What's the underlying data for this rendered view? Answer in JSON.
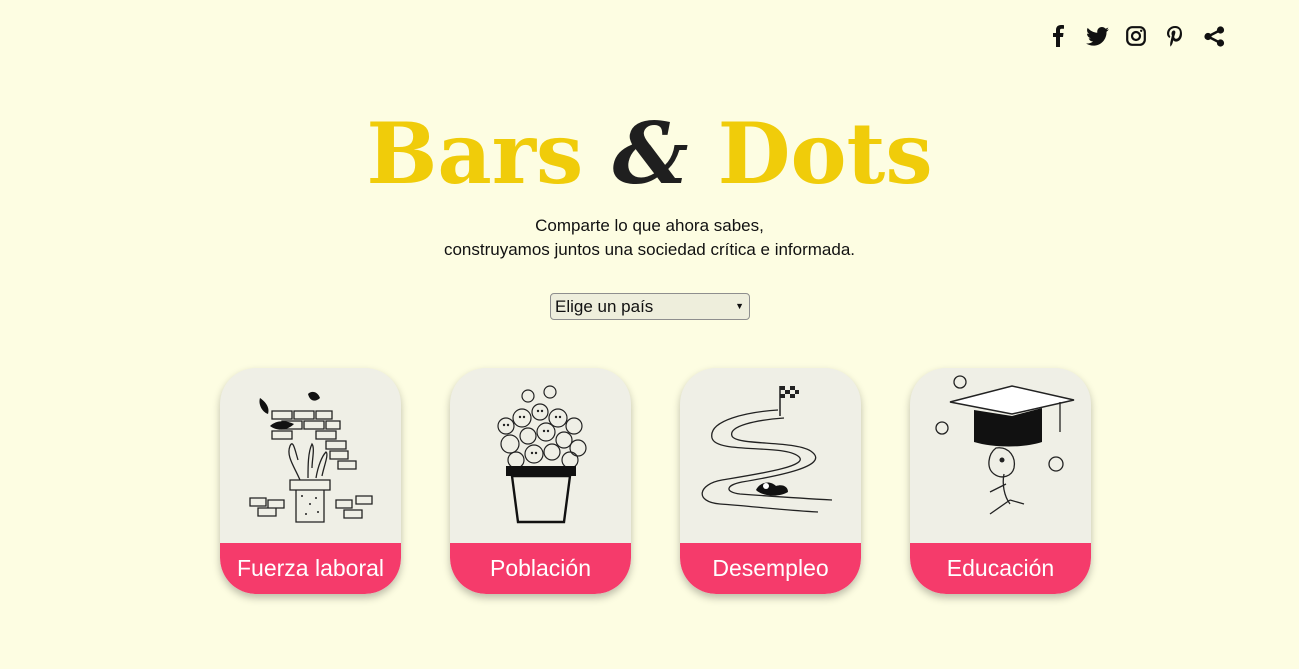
{
  "social": {
    "icons": [
      "facebook-icon",
      "twitter-icon",
      "instagram-icon",
      "pinterest-icon",
      "share-icon"
    ]
  },
  "header": {
    "title_part1": "Bars",
    "title_amp": "&",
    "title_part2": "Dots",
    "tagline_line1": "Comparte lo que ahora sabes,",
    "tagline_line2": "construyamos juntos una sociedad crítica e informada."
  },
  "country_select": {
    "selected": "Elige un país"
  },
  "cards": [
    {
      "label": "Fuerza laboral",
      "illustration": "hands-wall-illustration"
    },
    {
      "label": "Población",
      "illustration": "flowerpot-faces-illustration"
    },
    {
      "label": "Desempleo",
      "illustration": "winding-road-illustration"
    },
    {
      "label": "Educación",
      "illustration": "graduation-cap-illustration"
    }
  ],
  "colors": {
    "background": "#fdfde2",
    "title_yellow": "#f0cc0a",
    "card_label": "#f53b6b",
    "card_bg": "#efefe6"
  }
}
